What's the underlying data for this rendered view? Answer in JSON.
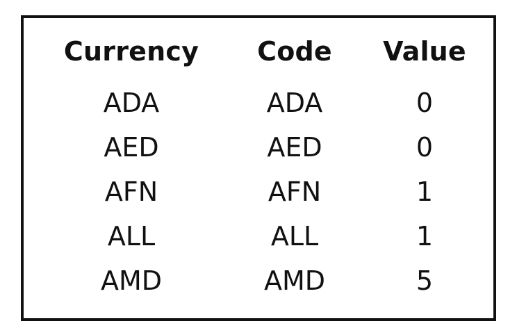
{
  "table": {
    "headers": [
      "Currency",
      "Code",
      "Value"
    ],
    "rows": [
      [
        "ADA",
        "ADA",
        "0"
      ],
      [
        "AED",
        "AED",
        "0"
      ],
      [
        "AFN",
        "AFN",
        "1"
      ],
      [
        "ALL",
        "ALL",
        "1"
      ],
      [
        "AMD",
        "AMD",
        "5"
      ]
    ]
  }
}
